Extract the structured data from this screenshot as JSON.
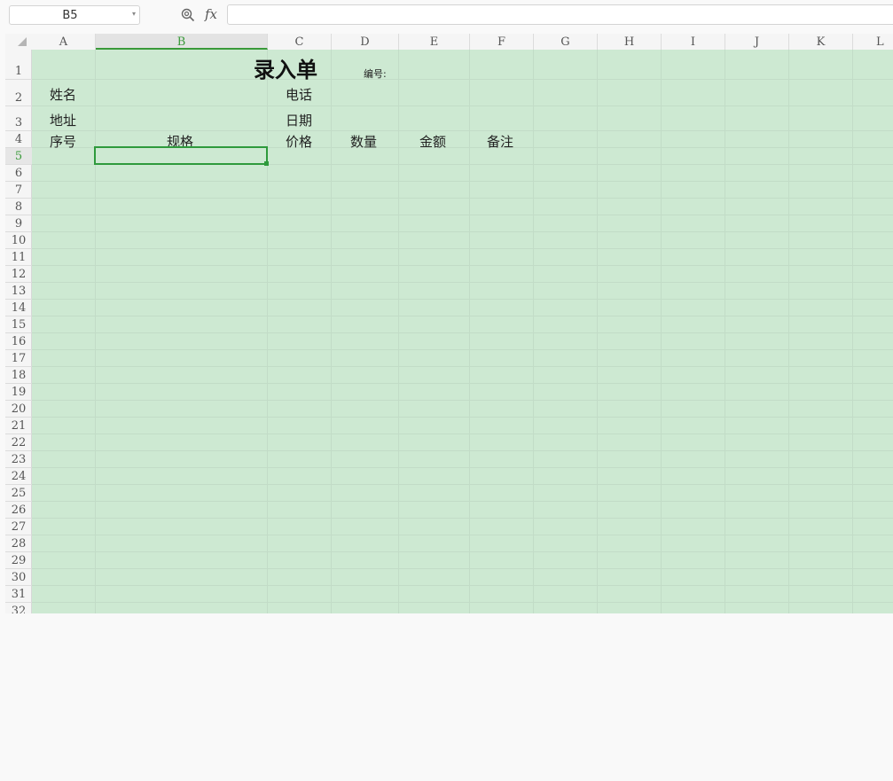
{
  "formula_bar": {
    "name_box": "B5",
    "formula": "",
    "fx_label": "fx"
  },
  "columns": [
    "A",
    "B",
    "C",
    "D",
    "E",
    "F",
    "G",
    "H",
    "I",
    "J",
    "K",
    "L"
  ],
  "selected_column": "B",
  "rows": [
    "1",
    "2",
    "3",
    "4",
    "5",
    "6",
    "7",
    "8",
    "9",
    "10",
    "11",
    "12",
    "13",
    "14",
    "15",
    "16",
    "17",
    "18",
    "19",
    "20",
    "21",
    "22",
    "23",
    "24",
    "25",
    "26",
    "27",
    "28",
    "29",
    "30",
    "31",
    "32"
  ],
  "selected_row": "5",
  "cells": {
    "title": "录入单",
    "number_label": "编号:",
    "name_label": "姓名",
    "phone_label": "电话",
    "address_label": "地址",
    "date_label": "日期",
    "seq_header": "序号",
    "spec_header": "规格",
    "price_header": "价格",
    "qty_header": "数量",
    "amount_header": "金额",
    "remark_header": "备注"
  },
  "colors": {
    "sheet_background": "#cde9d2",
    "selection": "#2e9a3c"
  }
}
